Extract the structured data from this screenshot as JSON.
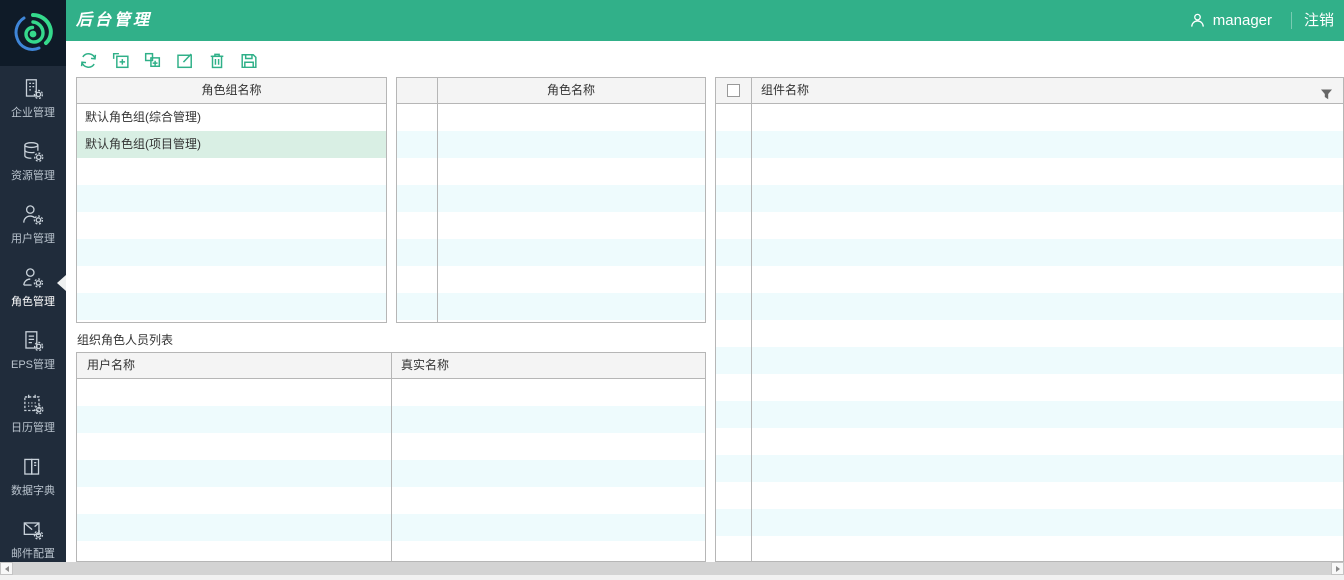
{
  "header": {
    "title": "后台管理",
    "user": "manager",
    "logout": "注销"
  },
  "sidebar": {
    "active_index": 3,
    "items": [
      {
        "label": "企业管理",
        "icon": "building-gear-icon"
      },
      {
        "label": "资源管理",
        "icon": "database-gear-icon"
      },
      {
        "label": "用户管理",
        "icon": "user-gear-icon"
      },
      {
        "label": "角色管理",
        "icon": "role-gear-icon"
      },
      {
        "label": "EPS管理",
        "icon": "document-gear-icon"
      },
      {
        "label": "日历管理",
        "icon": "calendar-gear-icon"
      },
      {
        "label": "数据字典",
        "icon": "book-icon"
      },
      {
        "label": "邮件配置",
        "icon": "mail-gear-icon"
      }
    ]
  },
  "toolbar": {
    "buttons": [
      {
        "name": "refresh",
        "icon": "refresh-icon"
      },
      {
        "name": "add",
        "icon": "add-icon"
      },
      {
        "name": "copy-add",
        "icon": "copy-add-icon"
      },
      {
        "name": "edit",
        "icon": "edit-icon"
      },
      {
        "name": "delete",
        "icon": "trash-icon"
      },
      {
        "name": "save",
        "icon": "save-icon"
      }
    ]
  },
  "panels": {
    "role_group": {
      "header": "角色组名称",
      "rows": [
        {
          "label": "默认角色组(综合管理)",
          "selected": false
        },
        {
          "label": "默认角色组(项目管理)",
          "selected": true
        }
      ]
    },
    "role": {
      "header": "角色名称"
    },
    "component": {
      "header": "组件名称",
      "filter_icon": "filter-icon",
      "checkbox_checked": false
    }
  },
  "org_list": {
    "title": "组织角色人员列表",
    "columns": [
      "用户名称",
      "真实名称"
    ]
  },
  "colors": {
    "accent_green": "#31b089",
    "sidebar_bg": "#202c3b",
    "logo_bg": "#0f1b28",
    "selected_row": "#d9efe4",
    "stripe": "#eefbfd",
    "table_header_bg": "#f4f4f4",
    "table_border": "#b6b6b6"
  }
}
